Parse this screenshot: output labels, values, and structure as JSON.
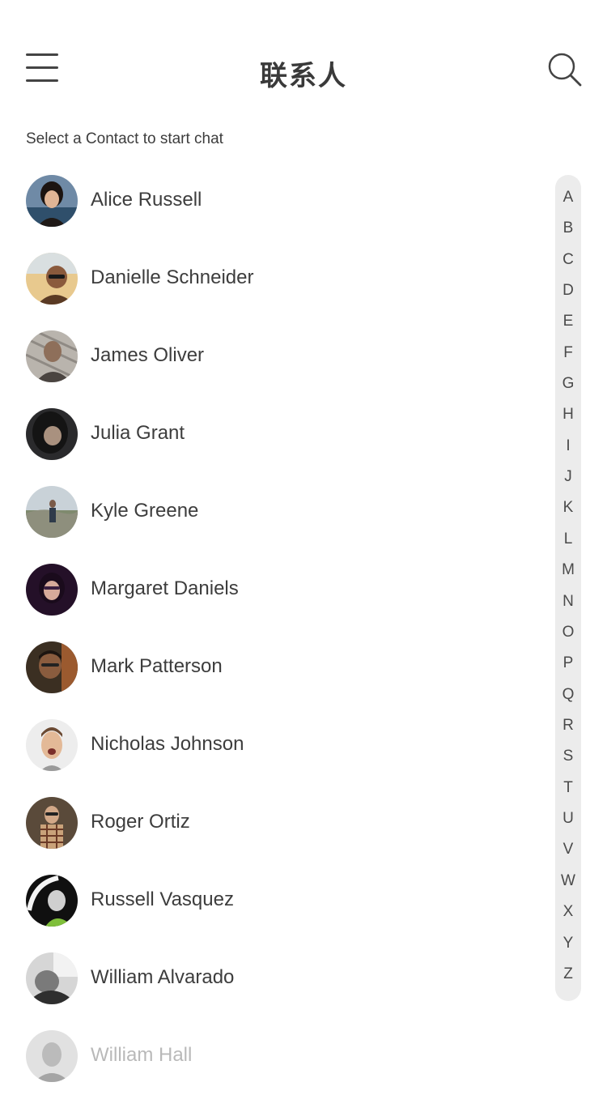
{
  "header": {
    "title": "联系人",
    "menu_icon": "hamburger-menu-icon",
    "search_icon": "search-icon"
  },
  "subtitle": "Select a Contact to start chat",
  "contacts": [
    {
      "name": "Alice Russell"
    },
    {
      "name": "Danielle Schneider"
    },
    {
      "name": "James Oliver"
    },
    {
      "name": "Julia Grant"
    },
    {
      "name": "Kyle Greene"
    },
    {
      "name": "Margaret Daniels"
    },
    {
      "name": "Mark Patterson"
    },
    {
      "name": "Nicholas Johnson"
    },
    {
      "name": "Roger Ortiz"
    },
    {
      "name": "Russell Vasquez"
    },
    {
      "name": "William Alvarado"
    },
    {
      "name": "William Hall"
    }
  ],
  "index_letters": [
    "A",
    "B",
    "C",
    "D",
    "E",
    "F",
    "G",
    "H",
    "I",
    "J",
    "K",
    "L",
    "M",
    "N",
    "O",
    "P",
    "Q",
    "R",
    "S",
    "T",
    "U",
    "V",
    "W",
    "X",
    "Y",
    "Z"
  ]
}
